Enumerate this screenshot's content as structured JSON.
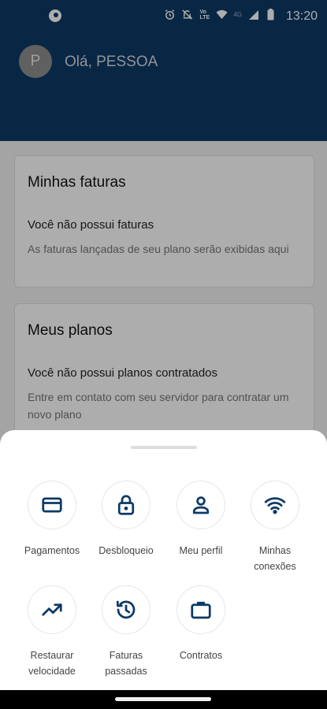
{
  "status_bar": {
    "time": "13:20",
    "network_label": "4G",
    "icons": [
      "app-notification-icon",
      "alarm-icon",
      "mute-icon",
      "volte-icon",
      "wifi-icon",
      "signal-icon",
      "battery-icon"
    ]
  },
  "header": {
    "avatar_initial": "P",
    "greeting": "Olá, PESSOA",
    "bg_color": "#0d3a66"
  },
  "cards": {
    "faturas": {
      "title": "Minhas faturas",
      "empty_title": "Você não possui faturas",
      "empty_desc": "As faturas lançadas de seu plano serão exibidas aqui"
    },
    "planos": {
      "title": "Meus planos",
      "empty_title": "Você não possui planos contratados",
      "empty_desc": "Entre em contato com seu servidor para contratar um novo plano"
    }
  },
  "bottom_sheet": {
    "actions": [
      {
        "label": "Pagamentos",
        "icon": "credit-card-icon"
      },
      {
        "label": "Desbloqueio",
        "icon": "lock-icon"
      },
      {
        "label": "Meu perfil",
        "icon": "person-icon"
      },
      {
        "label": "Minhas conexões",
        "icon": "wifi-icon"
      },
      {
        "label": "Restaurar velocidade",
        "icon": "trending-up-icon"
      },
      {
        "label": "Faturas passadas",
        "icon": "history-icon"
      },
      {
        "label": "Contratos",
        "icon": "briefcase-icon"
      }
    ]
  },
  "accent_color": "#0d3a66"
}
